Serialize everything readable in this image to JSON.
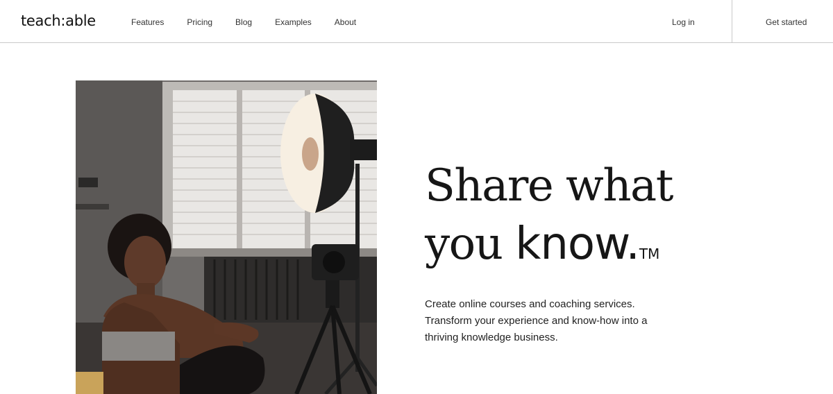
{
  "brand": {
    "logo_text": "teach:able"
  },
  "nav": {
    "links": [
      "Features",
      "Pricing",
      "Blog",
      "Examples",
      "About"
    ],
    "login_label": "Log in",
    "cta_label": "Get started"
  },
  "hero": {
    "headline_line1": "Share what",
    "headline_line2_a": "you ",
    "headline_line2_b": "know.",
    "trademark": "TM",
    "subtext_line1": "Create online courses and coaching services.",
    "subtext_line2": "Transform your experience and know-how into a",
    "subtext_line3": "thriving knowledge business."
  },
  "colors": {
    "text": "#161616",
    "border": "#c9c9c9",
    "background": "#ffffff"
  }
}
